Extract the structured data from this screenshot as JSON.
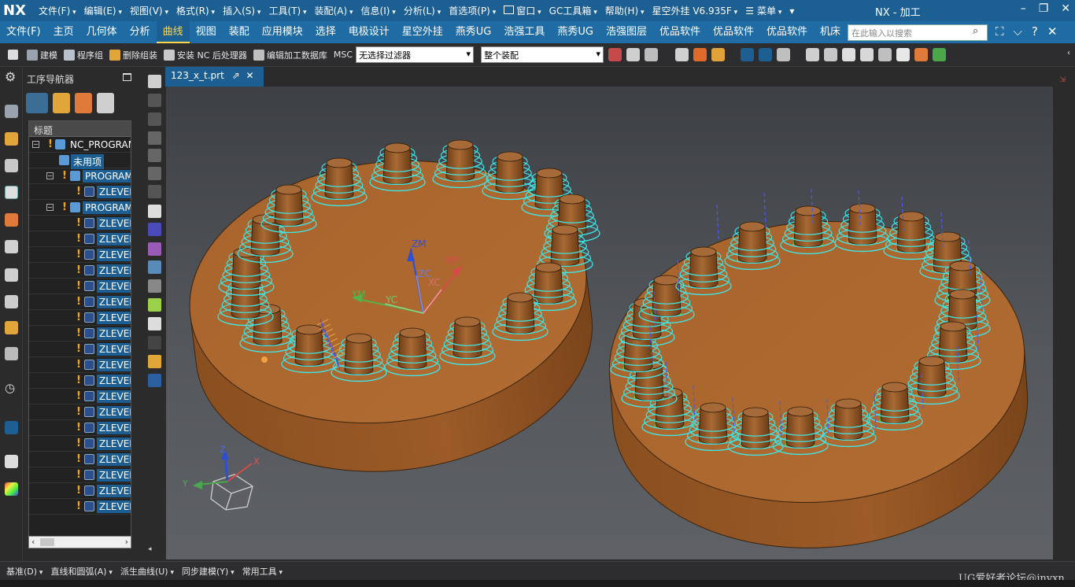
{
  "app": {
    "logo": "NX",
    "window_title": "NX - 加工",
    "menu": [
      {
        "label": "文件(F)",
        "dropdown": true
      },
      {
        "label": "编辑(E)",
        "dropdown": true
      },
      {
        "label": "视图(V)",
        "dropdown": true
      },
      {
        "label": "格式(R)",
        "dropdown": true
      },
      {
        "label": "插入(S)",
        "dropdown": true
      },
      {
        "label": "工具(T)",
        "dropdown": true
      },
      {
        "label": "装配(A)",
        "dropdown": true
      },
      {
        "label": "信息(I)",
        "dropdown": true
      },
      {
        "label": "分析(L)",
        "dropdown": true
      },
      {
        "label": "首选项(P)",
        "dropdown": true
      },
      {
        "label": "窗口",
        "dropdown": true
      },
      {
        "label": "GC工具箱",
        "dropdown": true
      },
      {
        "label": "帮助(H)",
        "dropdown": true
      },
      {
        "label": "星空外挂 V6.935F",
        "dropdown": true
      },
      {
        "label": "菜单",
        "dropdown": true
      }
    ]
  },
  "ribbon": {
    "tabs": [
      "文件(F)",
      "主页",
      "几何体",
      "分析",
      "曲线",
      "视图",
      "装配",
      "应用模块",
      "选择",
      "电极设计",
      "星空外挂",
      "燕秀UG",
      "浩强工具",
      "燕秀UG",
      "浩强图层",
      "优品软件",
      "优品软件",
      "优品软件",
      "机床"
    ],
    "active_tab": "曲线",
    "search_placeholder": "在此输入以搜索"
  },
  "toolbar": {
    "build": "建模",
    "program_group": "程序组",
    "delete_assembly": "删除组装",
    "install_post": "安装 NC 后处理器",
    "edit_library": "编辑加工数据库",
    "msc": "MSC",
    "filter_value": "无选择过滤器",
    "assembly_value": "整个装配"
  },
  "navigator": {
    "title": "工序导航器",
    "column_header": "标题",
    "root": "NC_PROGRAM",
    "unused": "未用项",
    "program": "PROGRAM",
    "operation": "ZLEVEL_PROFILE"
  },
  "document": {
    "tab_label": "123_x_t.prt"
  },
  "viewport": {
    "axis_labels": {
      "zm": "ZM",
      "xm": "XM",
      "ym": "YM",
      "zc": "ZC",
      "xc": "XC",
      "yc": "YC"
    },
    "triad_labels": {
      "z": "Z",
      "x": "X",
      "y": "Y"
    },
    "colors": {
      "part": "#a8642c",
      "toolpath_cyan": "#3fe6e6",
      "toolpath_green": "#6ee63a",
      "background_top": "#3d4045"
    }
  },
  "bottombar": {
    "items": [
      {
        "label": "基准(D)"
      },
      {
        "label": "直线和圆弧(A)"
      },
      {
        "label": "派生曲线(U)"
      },
      {
        "label": "同步建模(Y)"
      },
      {
        "label": "常用工具"
      }
    ]
  },
  "watermark": "UG爱好者论坛@jnyxn"
}
